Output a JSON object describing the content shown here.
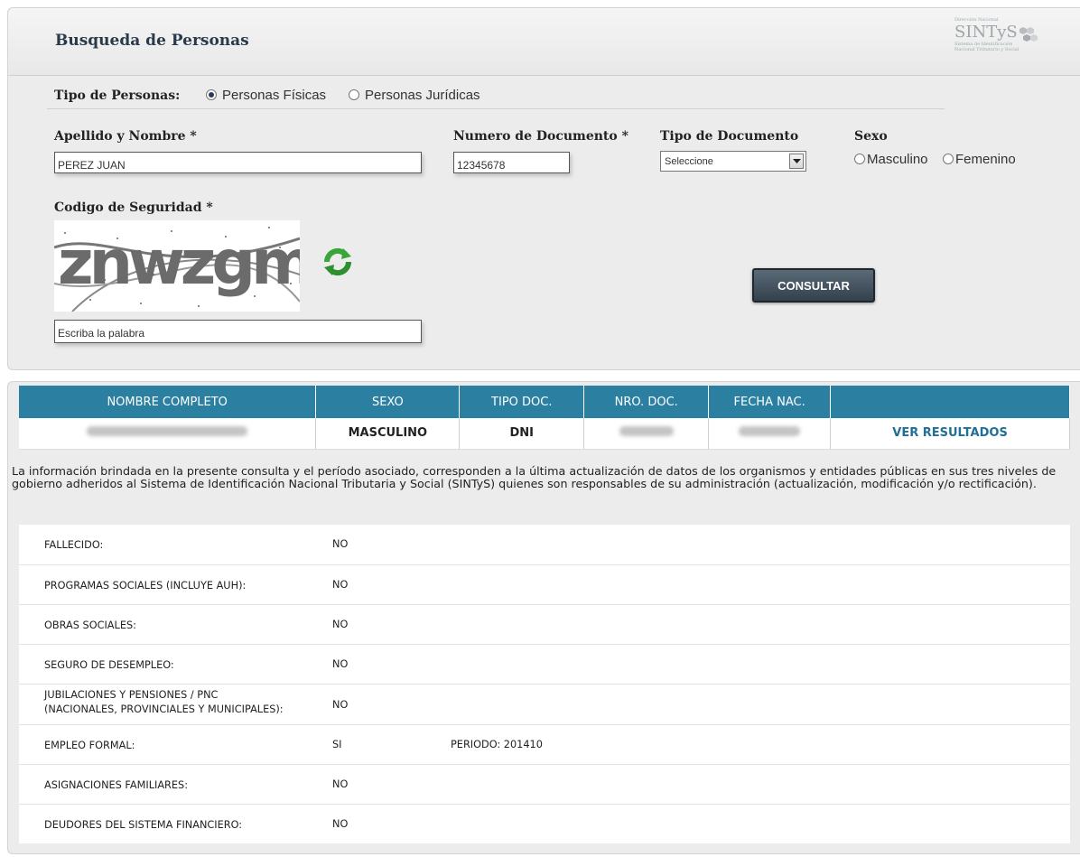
{
  "search": {
    "title": "Busqueda de Personas",
    "logo": {
      "line1": "Dirección Nacional",
      "brand": "SINTyS",
      "line2": "Sistema de Identificación",
      "line3": "Nacional Tributario y Social"
    },
    "tipo_label": "Tipo de Personas:",
    "tipo_options": [
      "Personas Físicas",
      "Personas Jurídicas"
    ],
    "tipo_selected": "Personas Físicas",
    "nombre_label": "Apellido y Nombre *",
    "nombre_value": "PEREZ JUAN",
    "documento_label": "Numero de Documento *",
    "documento_value": "12345678",
    "tipo_doc_label": "Tipo de Documento",
    "tipo_doc_selected": "Seleccione",
    "sexo_label": "Sexo",
    "sexo_options": [
      "Masculino",
      "Femenino"
    ],
    "codigo_label": "Codigo de Seguridad *",
    "captcha_text": "znwzgm",
    "captcha_input_value": "Escriba la palabra",
    "submit_label": "CONSULTAR"
  },
  "results": {
    "headers": [
      "NOMBRE COMPLETO",
      "SEXO",
      "TIPO DOC.",
      "NRO. DOC.",
      "FECHA NAC.",
      ""
    ],
    "row": {
      "sexo": "MASCULINO",
      "tipo_doc": "DNI",
      "link": "VER RESULTADOS"
    },
    "disclaimer": "La información brindada en la presente consulta y el período asociado, corresponden a la última actualización de datos de los organismos y entidades públicas en sus tres niveles de gobierno adheridos al Sistema de Identificación Nacional Tributaria y Social (SINTyS) quienes son responsables de su administración (actualización, modificación y/o rectificación).",
    "details": [
      {
        "label": "FALLECIDO:",
        "value": "NO",
        "extra": ""
      },
      {
        "label": "PROGRAMAS SOCIALES (INCLUYE AUH):",
        "value": "NO",
        "extra": ""
      },
      {
        "label": "OBRAS SOCIALES:",
        "value": "NO",
        "extra": ""
      },
      {
        "label": "SEGURO DE DESEMPLEO:",
        "value": "NO",
        "extra": ""
      },
      {
        "label": "JUBILACIONES Y PENSIONES / PNC",
        "label2": "(NACIONALES, PROVINCIALES Y MUNICIPALES):",
        "value": "NO",
        "extra": ""
      },
      {
        "label": "EMPLEO FORMAL:",
        "value": "SI",
        "extra": "PERIODO: 201410"
      },
      {
        "label": "ASIGNACIONES FAMILIARES:",
        "value": "NO",
        "extra": ""
      },
      {
        "label": "DEUDORES DEL SISTEMA FINANCIERO:",
        "value": "NO",
        "extra": ""
      }
    ]
  },
  "colors": {
    "header_blue": "#2b80a1",
    "link_blue": "#1f6f97",
    "button_dark": "#3b4852",
    "panel_gray": "#ececec"
  }
}
